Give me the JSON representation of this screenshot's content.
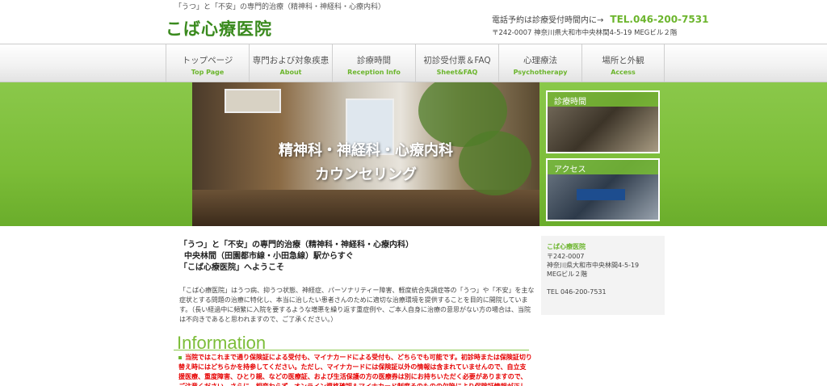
{
  "header": {
    "tagline": "「うつ」と「不安」の専門的治療（精神科・神経科・心療内科）",
    "logo": "こば心療医院",
    "phone_note": "電話予約は診療受付時間内に→",
    "phone": "TEL.046-200-7531",
    "address": "〒242-0007 神奈川県大和市中央林間4-5-19 MEGビル２階"
  },
  "nav": [
    {
      "jp": "トップページ",
      "en": "Top Page"
    },
    {
      "jp": "専門および対象疾患",
      "en": "About"
    },
    {
      "jp": "診療時間",
      "en": "Reception  Info"
    },
    {
      "jp": "初診受付票＆FAQ",
      "en": "Sheet&FAQ"
    },
    {
      "jp": "心理療法",
      "en": "Psychotherapy"
    },
    {
      "jp": "場所と外観",
      "en": "Access"
    }
  ],
  "hero": {
    "line1": "精神科・神経科・心療内科",
    "line2": "カウンセリング"
  },
  "banners": {
    "hours": "診療時間",
    "access": "アクセス"
  },
  "intro": {
    "line1": "「うつ」と「不安」の専門的治療（精神科・神経科・心療内科）",
    "line2": "中央林間（田園都市線・小田急線）駅からすぐ",
    "line3": "「こば心療医院」へようこそ"
  },
  "description": "「こば心療医院」はうつ病、抑うつ状態、神経症、パーソナリティー障害、軽度統合失調症等の「うつ」や「不安」を主な症状とする問題の治療に特化し、本当に治したい患者さんのために適切な治療環境を提供することを目的に開院しています。（長い経過中に頻繁に入院を要するような増悪を繰り返す重症例や、ご本人自身に治療の意思がない方の場合は、当院は不向きであると思われますので、ご了承ください。）",
  "information": {
    "heading": "Information",
    "text": "当院ではこれまで通り保険証による受付も、マイナカードによる受付も、どちらでも可能です。初診時または保険証切り替え時にはどちらかを持参してください。ただし、マイナカードには保険証以外の情報は含まれていませんので、自立支援医療、重度障害、ひとり親、などの医療証、および生活保護の方の医療券は別にお持ちいただく必要がありますので、ご注意ください。さらに、相変わらず、オンライン資格確認＆マイナカード制度そのものの欠陥により保険証情報が正しく参照で"
  },
  "sidebar": {
    "title": "こば心療医院",
    "postal": "〒242-0007",
    "address1": "神奈川県大和市中央林間4-5-19",
    "address2": "MEGビル２階",
    "tel": "TEL 046-200-7531"
  },
  "colors": {
    "accent_green": "#6cb52d",
    "logo_green": "#3a8a1e",
    "hero_green": "#7cbd38",
    "alert_red": "#e60000"
  }
}
